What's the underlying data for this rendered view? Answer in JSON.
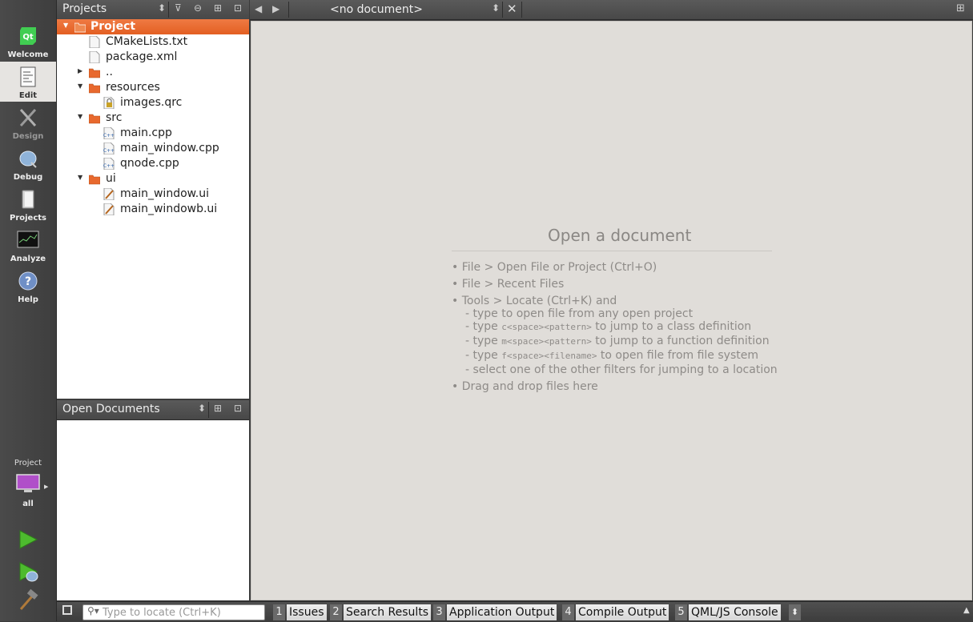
{
  "modes": [
    {
      "label": "Welcome",
      "icon": "qt-logo-icon"
    },
    {
      "label": "Edit",
      "icon": "edit-document-icon"
    },
    {
      "label": "Design",
      "icon": "design-tools-icon"
    },
    {
      "label": "Debug",
      "icon": "debug-bug-icon"
    },
    {
      "label": "Projects",
      "icon": "projects-folder-icon"
    },
    {
      "label": "Analyze",
      "icon": "analyze-monitor-icon"
    },
    {
      "label": "Help",
      "icon": "help-icon"
    }
  ],
  "kit": {
    "label": "Project",
    "name": "all"
  },
  "projects_panel": {
    "title": "Projects"
  },
  "tree": [
    {
      "label": "Project",
      "kind": "project"
    },
    {
      "label": "CMakeLists.txt",
      "kind": "file"
    },
    {
      "label": "package.xml",
      "kind": "file"
    },
    {
      "label": "..",
      "kind": "folder"
    },
    {
      "label": "resources",
      "kind": "folder"
    },
    {
      "label": "images.qrc",
      "kind": "qrc"
    },
    {
      "label": "src",
      "kind": "folder"
    },
    {
      "label": "main.cpp",
      "kind": "cpp"
    },
    {
      "label": "main_window.cpp",
      "kind": "cpp"
    },
    {
      "label": "qnode.cpp",
      "kind": "cpp"
    },
    {
      "label": "ui",
      "kind": "folder"
    },
    {
      "label": "main_window.ui",
      "kind": "ui"
    },
    {
      "label": "main_windowb.ui",
      "kind": "ui"
    }
  ],
  "open_documents": {
    "title": "Open Documents"
  },
  "editor": {
    "document": "<no document>",
    "welcome_title": "Open a document",
    "hints": {
      "open_file": "• File > Open File or Project (Ctrl+O)",
      "recent": "• File > Recent Files",
      "locate": "• Tools > Locate (Ctrl+K) and",
      "type_open": "- type to open file from any open project",
      "type_prefix": "- type",
      "class_code": "c<space><pattern>",
      "class_tail": "to jump to a class definition",
      "func_code": "m<space><pattern>",
      "func_tail": "to jump to a function definition",
      "file_code": "f<space><filename>",
      "file_tail": "to open file from file system",
      "filters": "- select one of the other filters for jumping to a location",
      "drag": "• Drag and drop files here"
    }
  },
  "statusbar": {
    "locate_placeholder": "Type to locate (Ctrl+K)",
    "tabs": [
      {
        "num": "1",
        "label": "Issues"
      },
      {
        "num": "2",
        "label": "Search Results"
      },
      {
        "num": "3",
        "label": "Application Output"
      },
      {
        "num": "4",
        "label": "Compile Output"
      },
      {
        "num": "5",
        "label": "QML/JS Console"
      }
    ]
  },
  "colors": {
    "accent": "#e8692e",
    "editor_bg": "#e0ddd9",
    "modebar": "#444444"
  }
}
